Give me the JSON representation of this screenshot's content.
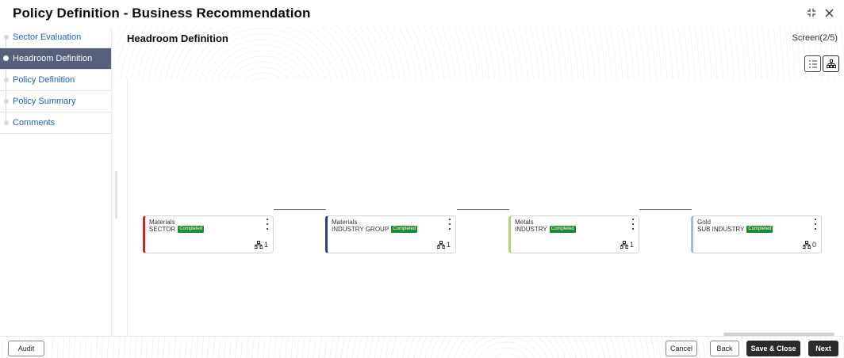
{
  "header": {
    "title": "Policy Definition - Business Recommendation",
    "icons": [
      "collapse-icon",
      "close-icon"
    ]
  },
  "sidebar": {
    "steps": [
      {
        "label": "Sector Evaluation",
        "state": "done"
      },
      {
        "label": "Headroom Definition",
        "state": "active"
      },
      {
        "label": "Policy Definition",
        "state": "pending"
      },
      {
        "label": "Policy Summary",
        "state": "pending"
      },
      {
        "label": "Comments",
        "state": "pending"
      }
    ]
  },
  "main": {
    "title": "Headroom Definition",
    "screen": "Screen(2/5)",
    "view_toggle": [
      "list-view-icon",
      "tree-view-icon"
    ]
  },
  "nodes": [
    {
      "name": "Materials",
      "level": "SECTOR",
      "status": "Completed",
      "count": "1",
      "accent": "#c0262b"
    },
    {
      "name": "Materials",
      "level": "INDUSTRY GROUP",
      "status": "Completed",
      "count": "1",
      "accent": "#2a3f7d"
    },
    {
      "name": "Metals",
      "level": "INDUSTRY",
      "status": "Completed",
      "count": "1",
      "accent": "#a8d86e"
    },
    {
      "name": "Gold",
      "level": "SUB INDUSTRY",
      "status": "Completed",
      "count": "0",
      "accent": "#a9b8e0"
    }
  ],
  "footer": {
    "audit": "Audit",
    "cancel": "Cancel",
    "back": "Back",
    "save_close": "Save & Close",
    "next": "Next"
  },
  "colors": {
    "active_step_bg": "#57607a",
    "link": "#1f5fbf",
    "badge": "#1e8a32",
    "primary_button": "#2b2b2b"
  }
}
